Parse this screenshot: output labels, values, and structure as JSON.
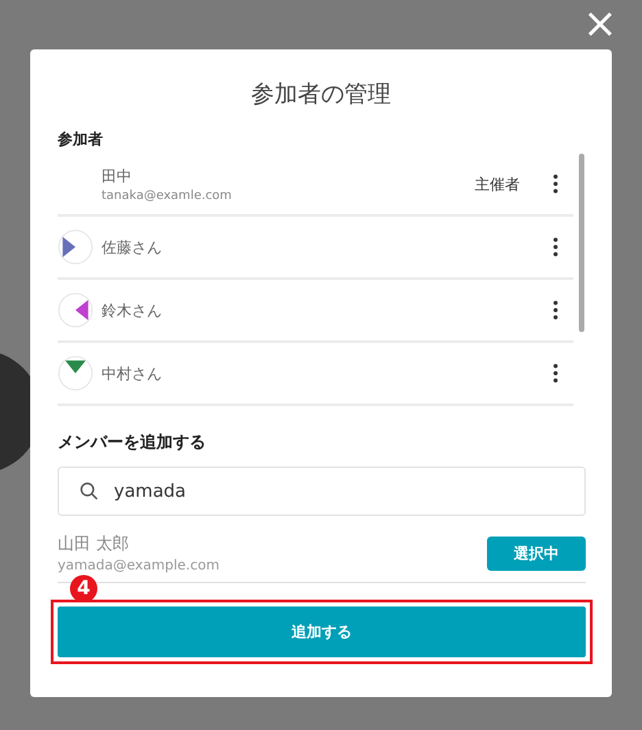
{
  "dialog": {
    "title": "参加者の管理",
    "close_icon": "×"
  },
  "participants": {
    "heading": "参加者",
    "items": [
      {
        "name": "田中",
        "email": "tanaka@examle.com",
        "role": "主催者",
        "avatar": false
      },
      {
        "name": "佐藤さん",
        "avatar": true,
        "color": "#6670b8"
      },
      {
        "name": "鈴木さん",
        "avatar": true,
        "color": "#c040d0"
      },
      {
        "name": "中村さん",
        "avatar": true,
        "color": "#2a8a4a"
      }
    ]
  },
  "add_member": {
    "heading": "メンバーを追加する",
    "search": {
      "value": "yamada"
    },
    "results": [
      {
        "name": "山田 太郎",
        "email": "yamada@example.com",
        "action": "選択中",
        "selected": true
      }
    ]
  },
  "callout": {
    "number": "4"
  },
  "submit_button": "追加する"
}
